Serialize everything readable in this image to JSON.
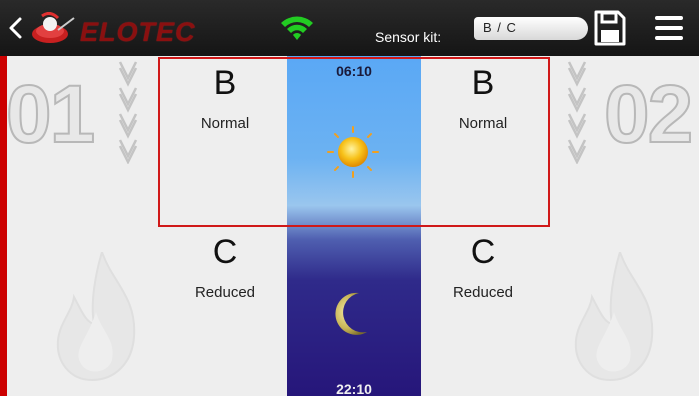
{
  "header": {
    "logo_text": "ELOTEC",
    "sensor_kit_label": "Sensor kit:",
    "sensor_kit_value": "B / C"
  },
  "zones": [
    {
      "number": "01"
    },
    {
      "number": "02"
    }
  ],
  "schedule": {
    "day_time": "06:10",
    "night_time": "22:10"
  },
  "day_mode": {
    "left_letter": "B",
    "left_label": "Normal",
    "right_letter": "B",
    "right_label": "Normal"
  },
  "night_mode": {
    "left_letter": "C",
    "left_label": "Reduced",
    "right_letter": "C",
    "right_label": "Reduced"
  },
  "icons": [
    "back-chevron-icon",
    "elotec-logo-icon",
    "wifi-icon",
    "save-icon",
    "menu-icon",
    "sun-icon",
    "moon-icon",
    "flame-icon",
    "chevron-down-icon"
  ],
  "colors": {
    "topbar": "#1c1c1c",
    "accent_red": "#cc0000",
    "wifi_green": "#22cc22",
    "sky_day": "#5aa8f5",
    "sky_night": "#26167a"
  }
}
